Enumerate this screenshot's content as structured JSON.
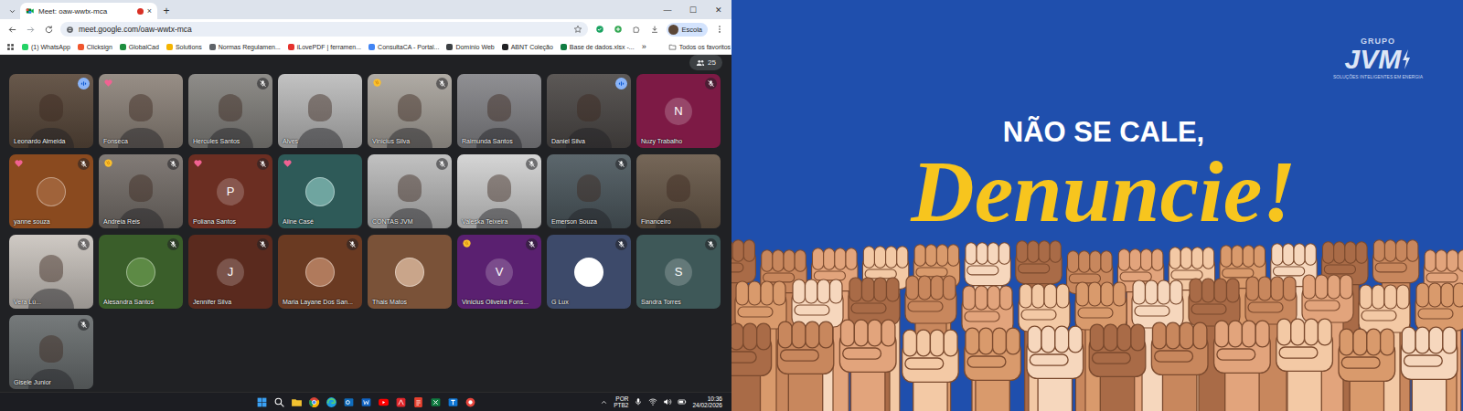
{
  "browser": {
    "tab": {
      "title": "Meet: oaw-wwtx-mca",
      "recording": true,
      "close": "×",
      "selected": true
    },
    "new_tab": "+",
    "window_controls": [
      "—",
      "☐",
      "✕"
    ],
    "url": "meet.google.com/oaw-wwtx-mca",
    "profile": "Escola",
    "bookmarks": [
      {
        "label": "(1) WhatsApp",
        "color": "#25d366"
      },
      {
        "label": "Clicksign",
        "color": "#f0552d"
      },
      {
        "label": "GlobalCad",
        "color": "#1e8e3e"
      },
      {
        "label": "Solutions",
        "color": "#f4b400"
      },
      {
        "label": "Normas Regulamen...",
        "color": "#5f6368"
      },
      {
        "label": "iLovePDF | ferramen...",
        "color": "#e5322d"
      },
      {
        "label": "ConsultaCA - Portal...",
        "color": "#4285f4"
      },
      {
        "label": "Domínio Web",
        "color": "#3c4043"
      },
      {
        "label": "ABNT Coleção",
        "color": "#202124"
      },
      {
        "label": "Base de dados.xlsx -...",
        "color": "#107c41"
      }
    ],
    "more_bookmarks": "»",
    "all_bookmarks": "Todos os favoritos"
  },
  "meet": {
    "participant_count": "25",
    "tiles": [
      {
        "name": "Leonardo Almeida",
        "kind": "video",
        "color": "#5b4a3c",
        "muted": false,
        "speaking": true,
        "reaction": "none"
      },
      {
        "name": "Fonseca",
        "kind": "video",
        "color": "#8f857c",
        "muted": false,
        "speaking": false,
        "reaction": "heart"
      },
      {
        "name": "Hercules Santos",
        "kind": "video",
        "color": "#85837f",
        "muted": true,
        "speaking": false,
        "reaction": "none"
      },
      {
        "name": "Alves",
        "kind": "video",
        "color": "#bdbdbd",
        "muted": false,
        "speaking": false,
        "reaction": "none"
      },
      {
        "name": "Vinicius Silva",
        "kind": "video",
        "color": "#a9a49d",
        "muted": true,
        "speaking": false,
        "reaction": "clap"
      },
      {
        "name": "Raimunda Santos",
        "kind": "video",
        "color": "#86868a",
        "muted": false,
        "speaking": false,
        "reaction": "none"
      },
      {
        "name": "Daniel Silva",
        "kind": "video",
        "color": "#4e4a48",
        "muted": false,
        "speaking": true,
        "reaction": "none"
      },
      {
        "name": "Nuzy Trabalho",
        "kind": "avatar-letter",
        "avatar": "N",
        "color": "#7d1a45",
        "muted": true,
        "speaking": false,
        "reaction": "none"
      },
      {
        "name": "yanne souza",
        "kind": "avatar-photo",
        "avatar_color": "#a0633a",
        "color": "#8a4a1f",
        "muted": true,
        "speaking": false,
        "reaction": "heart"
      },
      {
        "name": "Andreia Reis",
        "kind": "video",
        "color": "#77706b",
        "muted": true,
        "speaking": false,
        "reaction": "clap"
      },
      {
        "name": "Poliana Santos",
        "kind": "avatar-letter",
        "avatar": "P",
        "color": "#6b2e22",
        "muted": true,
        "speaking": false,
        "reaction": "heart"
      },
      {
        "name": "Aline Casé",
        "kind": "avatar-photo",
        "avatar_color": "#6fa5a0",
        "color": "#2e5a58",
        "muted": false,
        "speaking": false,
        "reaction": "heart"
      },
      {
        "name": "CONTAS JVM",
        "kind": "video",
        "color": "#bcbcbc",
        "muted": true,
        "speaking": false,
        "reaction": "none"
      },
      {
        "name": "Valeska Teixeira",
        "kind": "video",
        "color": "#d2d2d2",
        "muted": true,
        "speaking": false,
        "reaction": "none"
      },
      {
        "name": "Emerson Souza",
        "kind": "video",
        "color": "#4e5a60",
        "muted": true,
        "speaking": false,
        "reaction": "none"
      },
      {
        "name": "Financeiro",
        "kind": "video",
        "color": "#6a5a4a",
        "muted": false,
        "speaking": false,
        "reaction": "none"
      },
      {
        "name": "Vera Lú...",
        "kind": "video",
        "color": "#cbc5bf",
        "muted": true,
        "speaking": false,
        "reaction": "none"
      },
      {
        "name": "Alesandra Santos",
        "kind": "avatar-photo",
        "avatar_color": "#5d8a45",
        "color": "#3a5e2a",
        "muted": true,
        "speaking": false,
        "reaction": "none"
      },
      {
        "name": "Jennifer Silva",
        "kind": "avatar-letter",
        "avatar": "J",
        "color": "#5a2a1e",
        "muted": true,
        "speaking": false,
        "reaction": "none"
      },
      {
        "name": "Maria Layane Dos San...",
        "kind": "avatar-photo",
        "avatar_color": "#b07a5c",
        "color": "#6a3a22",
        "muted": true,
        "speaking": false,
        "reaction": "none"
      },
      {
        "name": "Thais Matos",
        "kind": "avatar-photo",
        "avatar_color": "#c9a58a",
        "color": "#7a5238",
        "muted": false,
        "speaking": false,
        "reaction": "none"
      },
      {
        "name": "Vinicius Oliveira Fons...",
        "kind": "avatar-letter",
        "avatar": "V",
        "color": "#5a2070",
        "muted": true,
        "speaking": false,
        "reaction": "clap"
      },
      {
        "name": "G Lux",
        "kind": "avatar-photo",
        "avatar_color": "#ffffff",
        "color": "#3d4a6a",
        "muted": true,
        "speaking": false,
        "reaction": "none"
      },
      {
        "name": "Sandra Torres",
        "kind": "avatar-letter",
        "avatar": "S",
        "color": "#3e5858",
        "muted": true,
        "speaking": false,
        "reaction": "none"
      },
      {
        "name": "Gisele Junior",
        "kind": "video",
        "color": "#6a6f70",
        "muted": true,
        "speaking": false,
        "reaction": "none"
      }
    ],
    "time": "10:36",
    "separator": "|",
    "meeting_code": "oaw-wwtx-mca",
    "controls": {
      "mic_muted": true,
      "reactions_open": true
    }
  },
  "taskbar": {
    "language": "POR",
    "layout": "PTB2",
    "time": "10:36",
    "date": "24/02/2026"
  },
  "poster": {
    "brand_top": "GRUPO",
    "brand": "JVM",
    "tagline": "SOLUÇÕES INTELIGENTES EM ENERGIA",
    "headline": "NÃO SE CALE,",
    "call": "Denuncie!"
  }
}
